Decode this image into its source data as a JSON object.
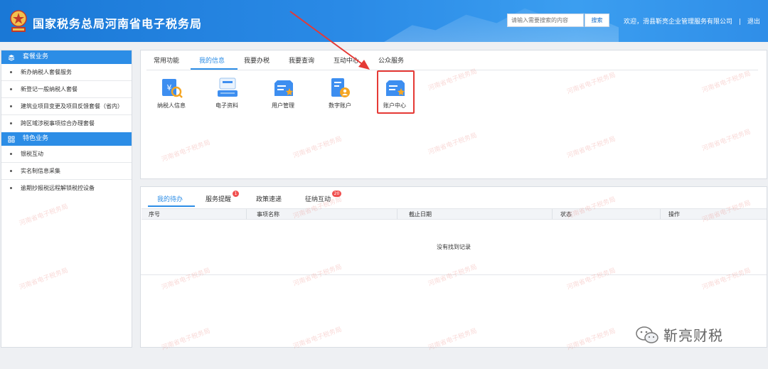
{
  "header": {
    "title": "国家税务总局河南省电子税务局",
    "search_placeholder": "请输入需要搜索的内容",
    "search_button": "搜索",
    "welcome": "欢迎，滑县靳亮企业管理服务有限公司",
    "separator": "|",
    "logout": "退出"
  },
  "sidebar": {
    "section1": {
      "title": "套餐业务",
      "icon": "stack-icon"
    },
    "section1_items": [
      "新办纳税人套餐服务",
      "新登记一般纳税人套餐",
      "建筑业项目变更及项目反馈套餐（省内）",
      "跨区域涉税事项综合办理套餐"
    ],
    "section2": {
      "title": "特色业务",
      "icon": "grid-icon"
    },
    "section2_items": [
      "银税互动",
      "实名制信息采集",
      "逾期抄报税远程解锁税控设备"
    ]
  },
  "panel_top": {
    "tabs": [
      "常用功能",
      "我的信息",
      "我要办税",
      "我要查询",
      "互动中心",
      "公众服务"
    ],
    "active_tab": "我的信息",
    "tiles": [
      {
        "label": "纳税人信息",
        "icon": "taxpayer-info-icon"
      },
      {
        "label": "电子资料",
        "icon": "electronic-data-icon"
      },
      {
        "label": "用户管理",
        "icon": "user-management-icon"
      },
      {
        "label": "数字账户",
        "icon": "digital-account-icon"
      },
      {
        "label": "账户中心",
        "icon": "account-center-icon"
      }
    ]
  },
  "panel_bottom": {
    "tabs": [
      "我的待办",
      "服务提醒",
      "政策速递",
      "征纳互动"
    ],
    "active_tab": "我的待办",
    "badges": {
      "service_reminder": "1",
      "tax_interaction": "20"
    },
    "columns": [
      "序号",
      "事项名称",
      "截止日期",
      "状态",
      "操作"
    ],
    "empty_text": "没有找到记录"
  },
  "watermark": "河南省电子税务局",
  "wechat_mark": "靳亮财税",
  "colors": {
    "primary": "#2c8de6",
    "header": "#1a78d6",
    "highlight": "#e53935",
    "badge": "#f04f4f"
  }
}
